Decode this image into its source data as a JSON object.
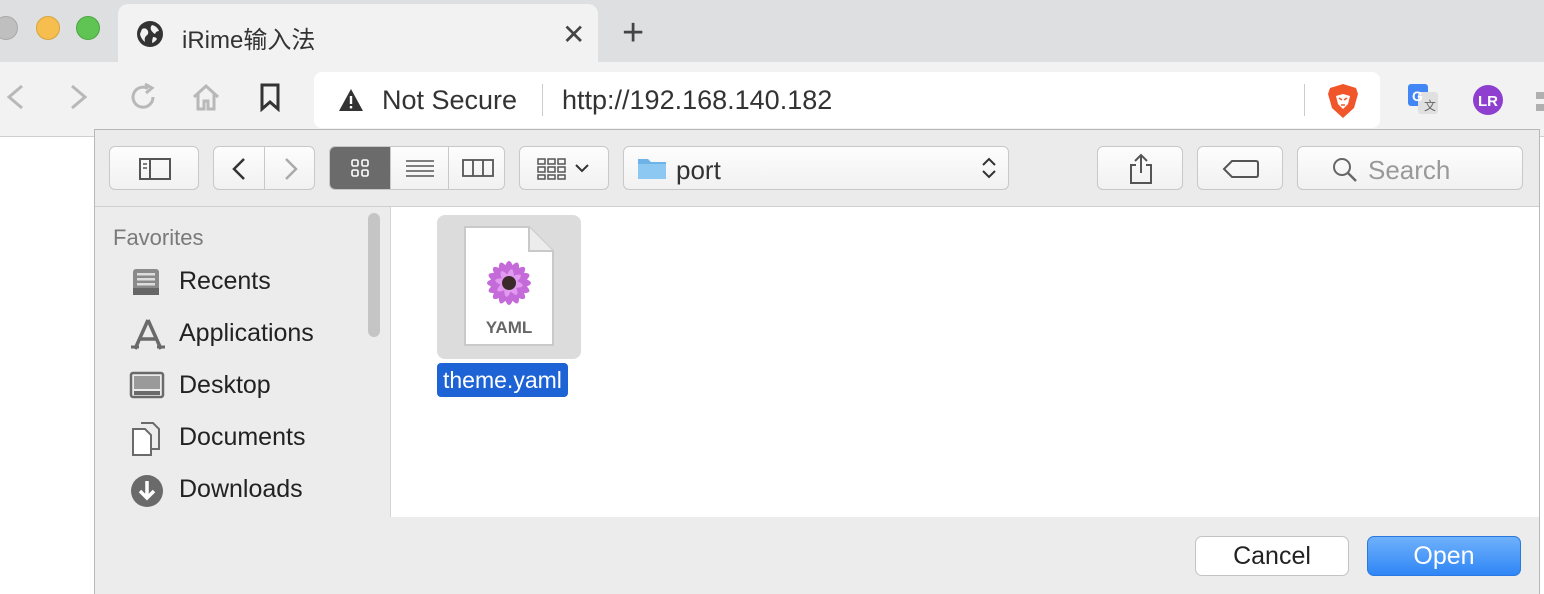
{
  "browser": {
    "tab": {
      "title": "iRime输入法",
      "close_icon": "close-icon"
    },
    "new_tab_symbol": "+",
    "security_label": "Not Secure",
    "url": "http://192.168.140.182"
  },
  "dialog": {
    "folder": "port",
    "search_placeholder": "Search",
    "sidebar": {
      "header": "Favorites",
      "items": [
        {
          "label": "Recents",
          "icon": "recents-icon"
        },
        {
          "label": "Applications",
          "icon": "applications-icon"
        },
        {
          "label": "Desktop",
          "icon": "desktop-icon"
        },
        {
          "label": "Documents",
          "icon": "documents-icon"
        },
        {
          "label": "Downloads",
          "icon": "downloads-icon"
        }
      ]
    },
    "files": [
      {
        "name": "theme.yaml",
        "type_label": "YAML",
        "selected": true
      }
    ],
    "cancel_label": "Cancel",
    "open_label": "Open"
  },
  "colors": {
    "accent": "#2f86f6",
    "selection": "#1d63d5"
  }
}
